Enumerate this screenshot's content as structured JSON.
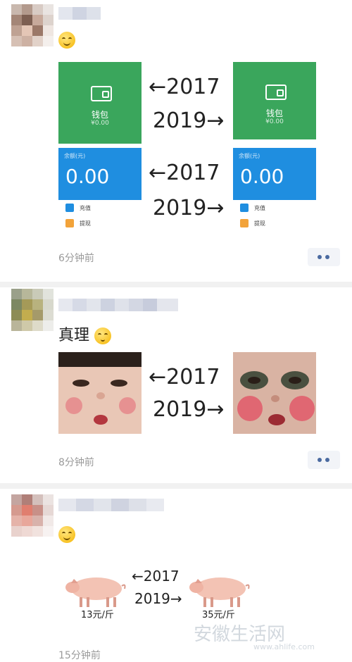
{
  "posts": [
    {
      "caption": "",
      "time": "6分钟前",
      "image": {
        "year_left": "←2017",
        "year_right": "2019→",
        "wallet_label": "钱包",
        "wallet_sub": "¥0.00",
        "balance_label": "余额(元)",
        "balance_value": "0.00",
        "row1": "充值",
        "row2": "提现"
      }
    },
    {
      "caption": "真理",
      "time": "8分钟前",
      "image": {
        "year_left": "←2017",
        "year_right": "2019→"
      }
    },
    {
      "caption": "",
      "time": "15分钟前",
      "image": {
        "year_left": "←2017",
        "year_right": "2019→",
        "price_left": "13元/斤",
        "price_right": "35元/斤"
      }
    }
  ],
  "watermark": {
    "text": "安徽生活网",
    "sub": "www.ahlife.com"
  },
  "colors": {
    "green": "#3aa65c",
    "blue": "#1f8ee0",
    "link": "#4a6aa0"
  }
}
